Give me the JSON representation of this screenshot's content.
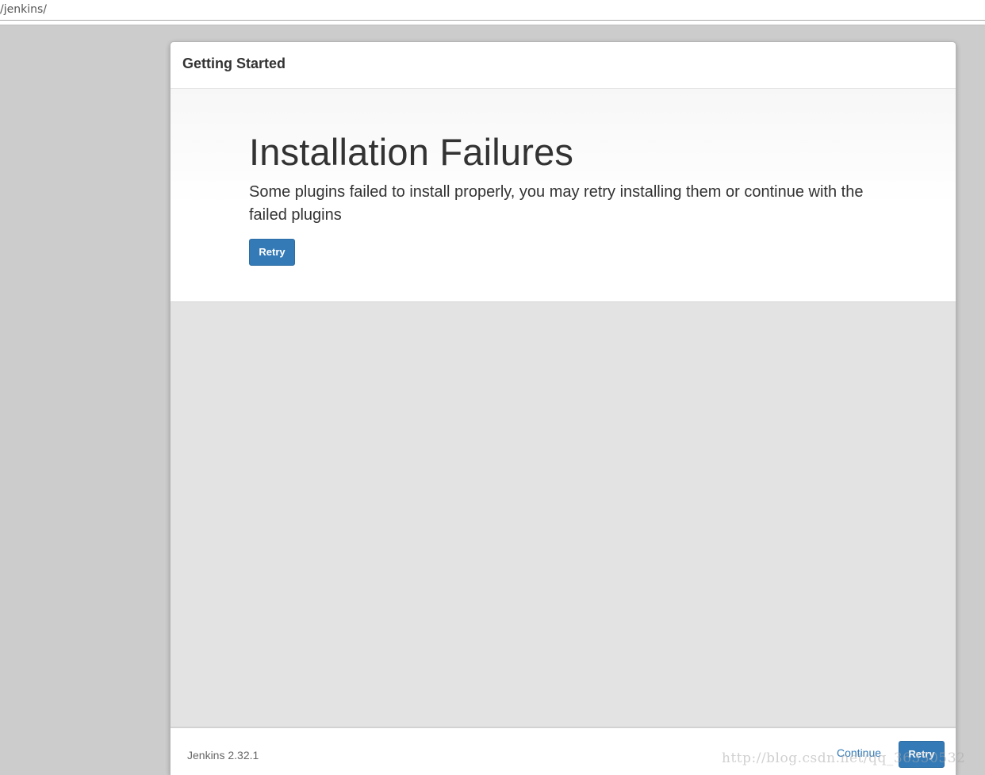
{
  "browser": {
    "address_text": "/jenkins/"
  },
  "dialog": {
    "title": "Getting Started",
    "hero": {
      "heading": "Installation Failures",
      "message": "Some plugins failed to install properly, you may retry installing them or continue with the failed plugins",
      "retry_label": "Retry"
    },
    "footer": {
      "version": "Jenkins 2.32.1",
      "continue_label": "Continue",
      "retry_label": "Retry"
    }
  },
  "watermark": "http://blog.csdn.net/qq_36350532",
  "colors": {
    "primary": "#337ab7",
    "page_background": "#cccccc",
    "body_area": "#e3e3e3"
  }
}
